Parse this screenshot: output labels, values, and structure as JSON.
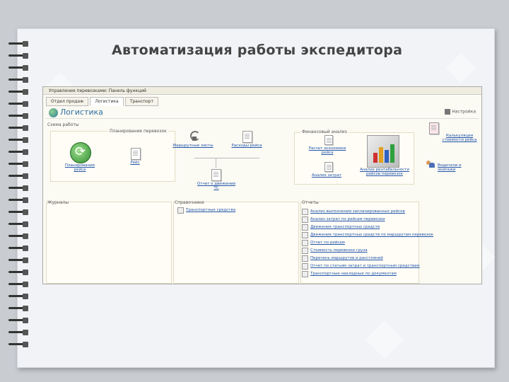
{
  "slide": {
    "title": "Автоматизация работы экспедитора"
  },
  "app": {
    "window_title": "Управление перевозками: Панель функций",
    "tabs": [
      {
        "label": "Отдел продаж",
        "active": false
      },
      {
        "label": "Логистика",
        "active": true
      },
      {
        "label": "Транспорт",
        "active": false
      }
    ],
    "name": "Логистика",
    "settings_label": "Настройка",
    "work_scheme": {
      "header": "Схема работы",
      "planning_header": "Планирование перевозок",
      "items": {
        "route_planning": "Планирование рейса",
        "trip": "Рейс",
        "route_sheets": "Маршрутные листы",
        "expenses": "Расходы рейса",
        "vehicle_movement": "Отчет о движении ТС"
      }
    },
    "finance": {
      "header": "Финансовый анализ",
      "items": {
        "economics": "Расчет экономики рейса",
        "results": "Анализ затрат",
        "profitability": "Анализ рентабельности рейсов перевозок"
      }
    },
    "right_panel": {
      "items": {
        "cost_calc": "Калькуляция стоимости рейса",
        "drivers": "Водители и экипажи"
      }
    },
    "journals": {
      "header": "Журналы"
    },
    "references": {
      "header": "Справочники",
      "items": [
        "Транспортные средства"
      ]
    },
    "reports": {
      "header": "Отчеты",
      "items": [
        "Анализ выполнения запланированных рейсов",
        "Анализ затрат по рейсам перевозки",
        "Движение транспортных средств",
        "Движение транспортных средств по маршрутам перевозок",
        "Отчет по рейсам",
        "Стоимость перевозки груза",
        "Перечень маршрутов и расстояний",
        "Отчет по статьям затрат и транспортным средствам",
        "Транспортные накладные по документам"
      ]
    }
  }
}
